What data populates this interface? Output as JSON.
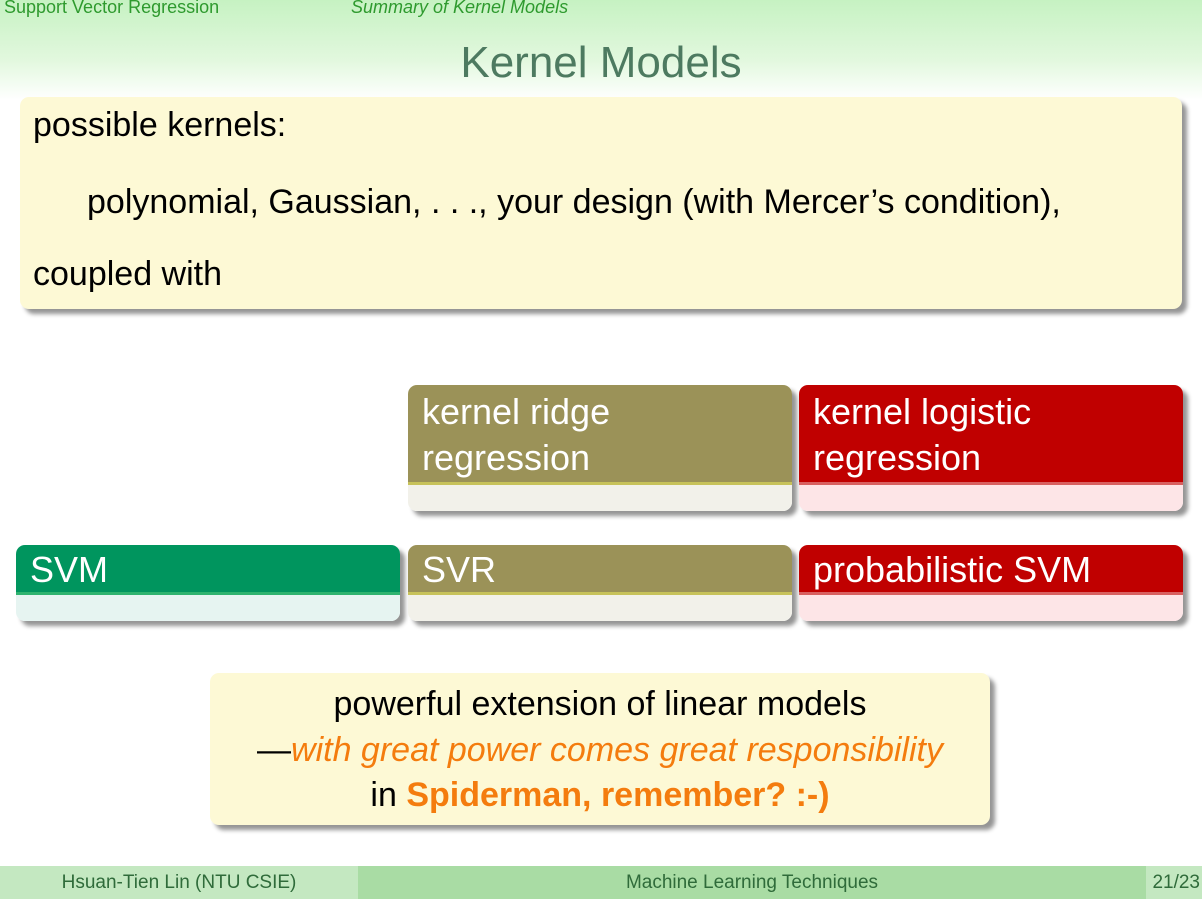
{
  "nav": {
    "section": "Support Vector Regression",
    "subsection": "Summary of Kernel Models"
  },
  "title": "Kernel Models",
  "kernels_block": {
    "line1": "possible kernels:",
    "line2": "polynomial, Gaussian, . . ., your design (with Mercer’s condition),",
    "line3": "coupled with"
  },
  "models": {
    "kernel_ridge": "kernel ridge\nregression",
    "kernel_ridge_l1": "kernel ridge",
    "kernel_ridge_l2": "regression",
    "kernel_logistic_l1": "kernel logistic",
    "kernel_logistic_l2": "regression",
    "svm": "SVM",
    "svr": "SVR",
    "prob_svm": "probabilistic SVM"
  },
  "summary": {
    "line1": "powerful extension of linear models",
    "dash": "—",
    "line2_italic": "with great power comes great responsibility",
    "line3_prefix": "in ",
    "line3_bold": "Spiderman, remember? :-)"
  },
  "footer": {
    "author": "Hsuan-Tien Lin  (NTU CSIE)",
    "course": "Machine Learning Techniques",
    "page": "21/23"
  },
  "colors": {
    "olive": "#9b9258",
    "red": "#c00000",
    "green": "#00955e",
    "accent_orange": "#f47c0e",
    "title": "#4d7a60"
  }
}
